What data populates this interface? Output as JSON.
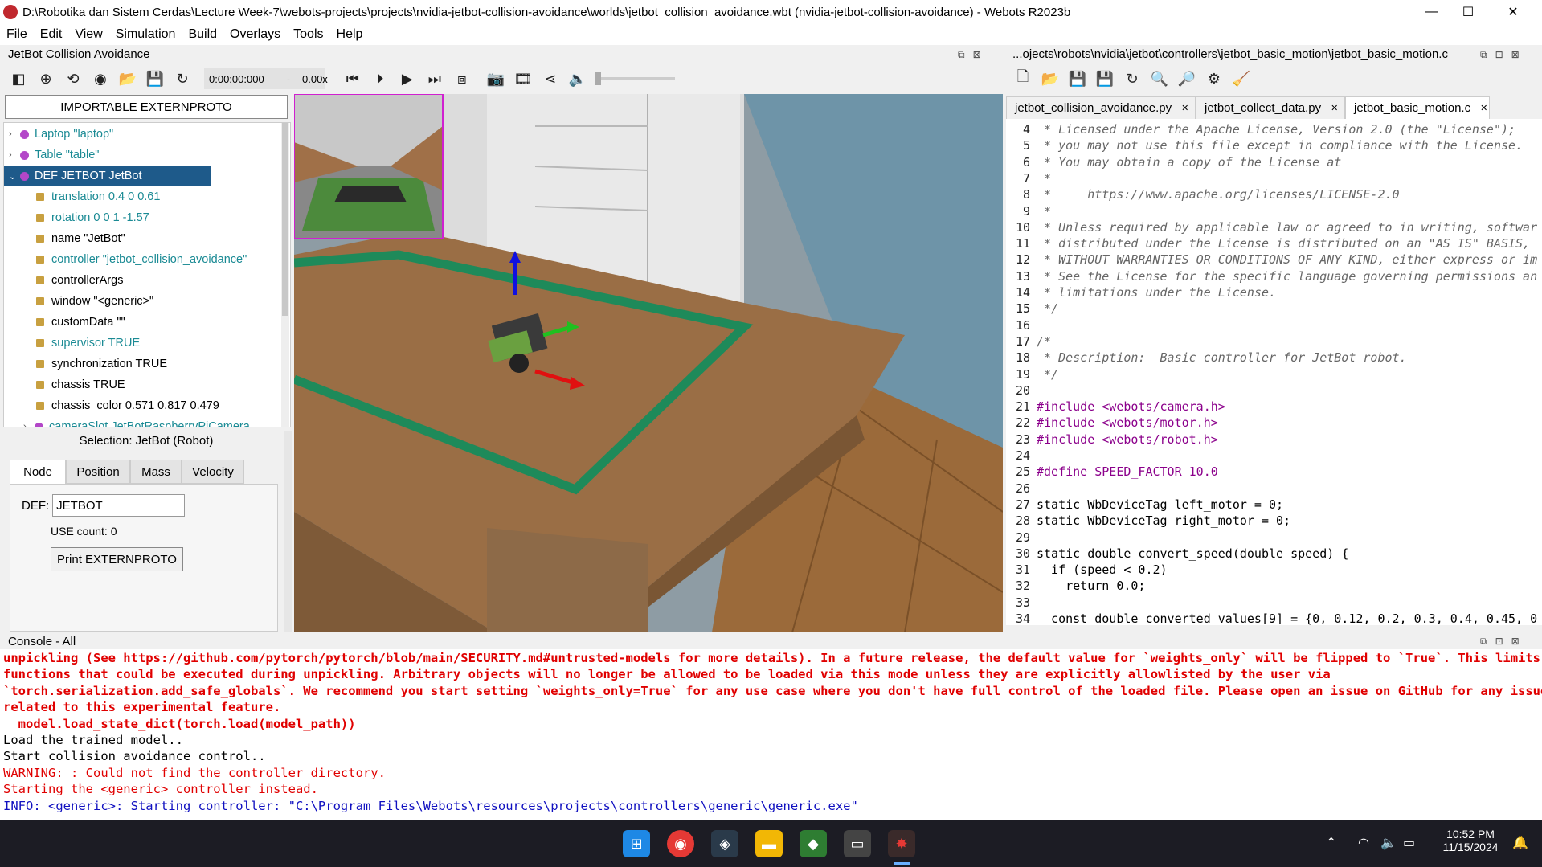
{
  "window": {
    "title": "D:\\Robotika dan Sistem Cerdas\\Lecture Week-7\\webots-projects\\projects\\nvidia-jetbot-collision-avoidance\\worlds\\jetbot_collision_avoidance.wbt (nvidia-jetbot-collision-avoidance) - Webots R2023b",
    "minimize": "—",
    "maximize": "☐",
    "close": "✕"
  },
  "menu": [
    "File",
    "Edit",
    "View",
    "Simulation",
    "Build",
    "Overlays",
    "Tools",
    "Help"
  ],
  "scene_panel": {
    "title": "JetBot Collision Avoidance",
    "time": "0:00:00:000",
    "speed": "-",
    "speed_value": "0.00x",
    "externproto_button": "IMPORTABLE EXTERNPROTO"
  },
  "tree": [
    {
      "text": "Laptop \"laptop\"",
      "kind": "node",
      "teal": true,
      "expander": "›"
    },
    {
      "text": "Table \"table\"",
      "kind": "node",
      "teal": true,
      "expander": "›"
    },
    {
      "text": "DEF JETBOT JetBot",
      "kind": "node",
      "teal": false,
      "expander": "⌄",
      "selected": true
    },
    {
      "text": "translation 0.4 0 0.61",
      "kind": "field",
      "teal": true
    },
    {
      "text": "rotation 0 0 1 -1.57",
      "kind": "field",
      "teal": true
    },
    {
      "text": "name \"JetBot\"",
      "kind": "field",
      "teal": false
    },
    {
      "text": "controller \"jetbot_collision_avoidance\"",
      "kind": "field",
      "teal": true
    },
    {
      "text": "controllerArgs",
      "kind": "field",
      "teal": false
    },
    {
      "text": "window \"<generic>\"",
      "kind": "field",
      "teal": false
    },
    {
      "text": "customData \"\"",
      "kind": "field",
      "teal": false
    },
    {
      "text": "supervisor TRUE",
      "kind": "field",
      "teal": true
    },
    {
      "text": "synchronization TRUE",
      "kind": "field",
      "teal": false
    },
    {
      "text": "chassis TRUE",
      "kind": "field",
      "teal": false
    },
    {
      "text": "chassis_color 0.571 0.817 0.479",
      "kind": "field",
      "teal": false
    },
    {
      "text": "cameraSlot JetBotRaspberryPiCamera",
      "kind": "node",
      "teal": true,
      "expander": "›"
    }
  ],
  "selection": {
    "label": "Selection: JetBot (Robot)",
    "tabs": [
      "Node",
      "Position",
      "Mass",
      "Velocity"
    ],
    "def_label": "DEF:",
    "def_value": "JETBOT",
    "use_count": "USE count: 0",
    "print_button": "Print EXTERNPROTO"
  },
  "editor": {
    "title": "...ojects\\robots\\nvidia\\jetbot\\controllers\\jetbot_basic_motion\\jetbot_basic_motion.c",
    "tabs": [
      "jetbot_collision_avoidance.py",
      "jetbot_collect_data.py",
      "jetbot_basic_motion.c"
    ],
    "tab_close": "✕",
    "lines": [
      {
        "n": "4",
        "t": " * Licensed under the Apache License, Version 2.0 (the \"License\");",
        "c": "cm"
      },
      {
        "n": "5",
        "t": " * you may not use this file except in compliance with the License.",
        "c": "cm"
      },
      {
        "n": "6",
        "t": " * You may obtain a copy of the License at",
        "c": "cm"
      },
      {
        "n": "7",
        "t": " *",
        "c": "cm"
      },
      {
        "n": "8",
        "t": " *     https://www.apache.org/licenses/LICENSE-2.0",
        "c": "cm"
      },
      {
        "n": "9",
        "t": " *",
        "c": "cm"
      },
      {
        "n": "10",
        "t": " * Unless required by applicable law or agreed to in writing, softwar",
        "c": "cm"
      },
      {
        "n": "11",
        "t": " * distributed under the License is distributed on an \"AS IS\" BASIS,",
        "c": "cm"
      },
      {
        "n": "12",
        "t": " * WITHOUT WARRANTIES OR CONDITIONS OF ANY KIND, either express or im",
        "c": "cm"
      },
      {
        "n": "13",
        "t": " * See the License for the specific language governing permissions an",
        "c": "cm"
      },
      {
        "n": "14",
        "t": " * limitations under the License.",
        "c": "cm"
      },
      {
        "n": "15",
        "t": " */",
        "c": "cm"
      },
      {
        "n": "16",
        "t": "",
        "c": ""
      },
      {
        "n": "17",
        "t": "/*",
        "c": "cm"
      },
      {
        "n": "18",
        "t": " * Description:  Basic controller for JetBot robot.",
        "c": "cm"
      },
      {
        "n": "19",
        "t": " */",
        "c": "cm"
      },
      {
        "n": "20",
        "t": "",
        "c": ""
      },
      {
        "n": "21",
        "t": "#include <webots/camera.h>",
        "c": "inc"
      },
      {
        "n": "22",
        "t": "#include <webots/motor.h>",
        "c": "inc"
      },
      {
        "n": "23",
        "t": "#include <webots/robot.h>",
        "c": "inc"
      },
      {
        "n": "24",
        "t": "",
        "c": ""
      },
      {
        "n": "25",
        "t": "#define SPEED_FACTOR 10.0",
        "c": "inc"
      },
      {
        "n": "26",
        "t": "",
        "c": ""
      },
      {
        "n": "27",
        "t": "static WbDeviceTag left_motor = 0;",
        "c": ""
      },
      {
        "n": "28",
        "t": "static WbDeviceTag right_motor = 0;",
        "c": ""
      },
      {
        "n": "29",
        "t": "",
        "c": ""
      },
      {
        "n": "30",
        "t": "static double convert_speed(double speed) {",
        "c": ""
      },
      {
        "n": "31",
        "t": "  if (speed < 0.2)",
        "c": ""
      },
      {
        "n": "32",
        "t": "    return 0.0;",
        "c": ""
      },
      {
        "n": "33",
        "t": "",
        "c": ""
      },
      {
        "n": "34",
        "t": "  const double converted_values[9] = {0, 0.12, 0.2, 0.3, 0.4, 0.45, 0",
        "c": ""
      }
    ]
  },
  "console": {
    "title": "Console - All",
    "lines": [
      {
        "t": "unpickling (See https://github.com/pytorch/pytorch/blob/main/SECURITY.md#untrusted-models for more details). In a future release, the default value for `weights_only` will be flipped to `True`. This limits the",
        "c": "err"
      },
      {
        "t": "functions that could be executed during unpickling. Arbitrary objects will no longer be allowed to be loaded via this mode unless they are explicitly allowlisted by the user via",
        "c": "err"
      },
      {
        "t": "`torch.serialization.add_safe_globals`. We recommend you start setting `weights_only=True` for any use case where you don't have full control of the loaded file. Please open an issue on GitHub for any issues",
        "c": "err"
      },
      {
        "t": "related to this experimental feature.",
        "c": "err"
      },
      {
        "t": "  model.load_state_dict(torch.load(model_path))",
        "c": "err"
      },
      {
        "t": "Load the trained model..",
        "c": ""
      },
      {
        "t": "Start collision avoidance control..",
        "c": ""
      },
      {
        "t": "WARNING: : Could not find the controller directory.",
        "c": "warn"
      },
      {
        "t": "Starting the <generic> controller instead.",
        "c": "warn"
      },
      {
        "t": "INFO: <generic>: Starting controller: \"C:\\Program Files\\Webots\\resources\\projects\\controllers\\generic\\generic.exe\"",
        "c": "info"
      }
    ]
  },
  "taskbar": {
    "time": "10:52 PM",
    "date": "11/15/2024"
  }
}
